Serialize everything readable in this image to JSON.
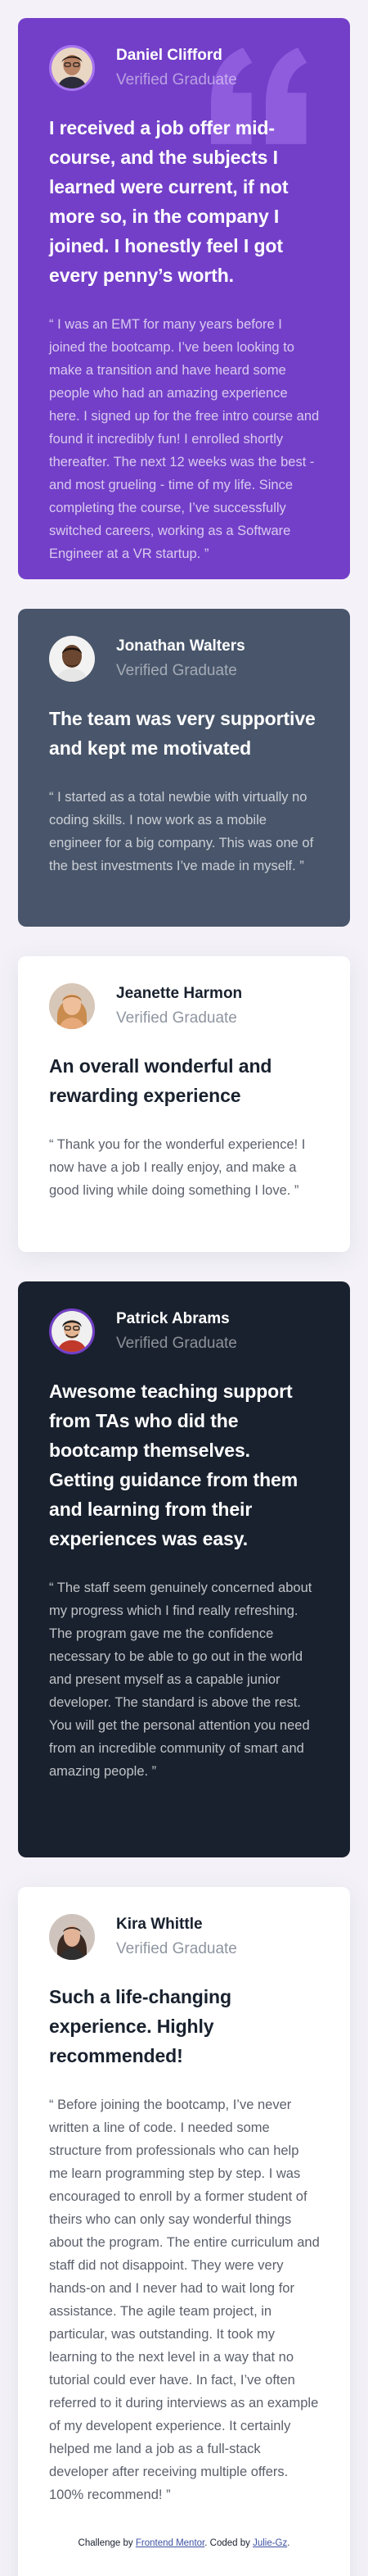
{
  "testimonials": [
    {
      "name": "Daniel Clifford",
      "status": "Verified Graduate",
      "headline": "I received a job offer mid-course, and the subjects I learned were current, if not more so, in the company I joined. I honestly feel I got every penny’s worth.",
      "body": "“ I was an EMT for many years before I joined the bootcamp. I’ve been looking to make a transition and have heard some people who had an amazing experience here. I signed up for the free intro course and found it incredibly fun! I enrolled shortly thereafter. The next 12 weeks was the best - and most grueling - time of my life. Since completing the course, I’ve successfully switched careers, working as a Software Engineer at a VR startup. ”"
    },
    {
      "name": "Jonathan Walters",
      "status": "Verified Graduate",
      "headline": "The team was very supportive and kept me motivated",
      "body": "“ I started as a total newbie with virtually no coding skills. I now work as a mobile engineer for a big company. This was one of the best investments I’ve made in myself. ”"
    },
    {
      "name": "Jeanette Harmon",
      "status": "Verified Graduate",
      "headline": "An overall wonderful and rewarding experience",
      "body": "“ Thank you for the wonderful experience! I now have a job I really enjoy, and make a good living while doing something I love. ”"
    },
    {
      "name": "Patrick Abrams",
      "status": "Verified Graduate",
      "headline": "Awesome teaching support from TAs who did the bootcamp themselves. Getting guidance from them and learning from their experiences was easy.",
      "body": "“ The staff seem genuinely concerned about my progress which I find really refreshing. The program gave me the confidence necessary to be able to go out in the world and present myself as a capable junior developer. The standard is above the rest. You will get the personal attention you need from an incredible community of smart and amazing people. ”"
    },
    {
      "name": "Kira Whittle",
      "status": "Verified Graduate",
      "headline": "Such a life-changing experience. Highly recommended!",
      "body": "“ Before joining the bootcamp, I’ve never written a line of code. I needed some structure from professionals who can help me learn programming step by step. I was encouraged to enroll by a former student of theirs who can only say wonderful things about the program. The entire curriculum and staff did not disappoint. They were very hands-on and I never had to wait long for assistance. The agile team project, in particular, was outstanding. It took my learning to the next level in a way that no tutorial could ever have. In fact, I’ve often referred to it during interviews as an example of my developent experience. It certainly helped me land a job as a full-stack developer after receiving multiple offers. 100% recommend! ”"
    }
  ],
  "attribution": {
    "prefix": "Challenge by",
    "link1": "Frontend Mentor",
    "middle": ". Coded by",
    "link2": "Julie-Gz",
    "suffix": "."
  },
  "colors": {
    "purple": "#733fc8",
    "slate": "#48556a",
    "dark": "#19212e",
    "white": "#ffffff",
    "background": "#f4f2f8"
  },
  "icons": {
    "quote": "quotation-mark-icon"
  }
}
